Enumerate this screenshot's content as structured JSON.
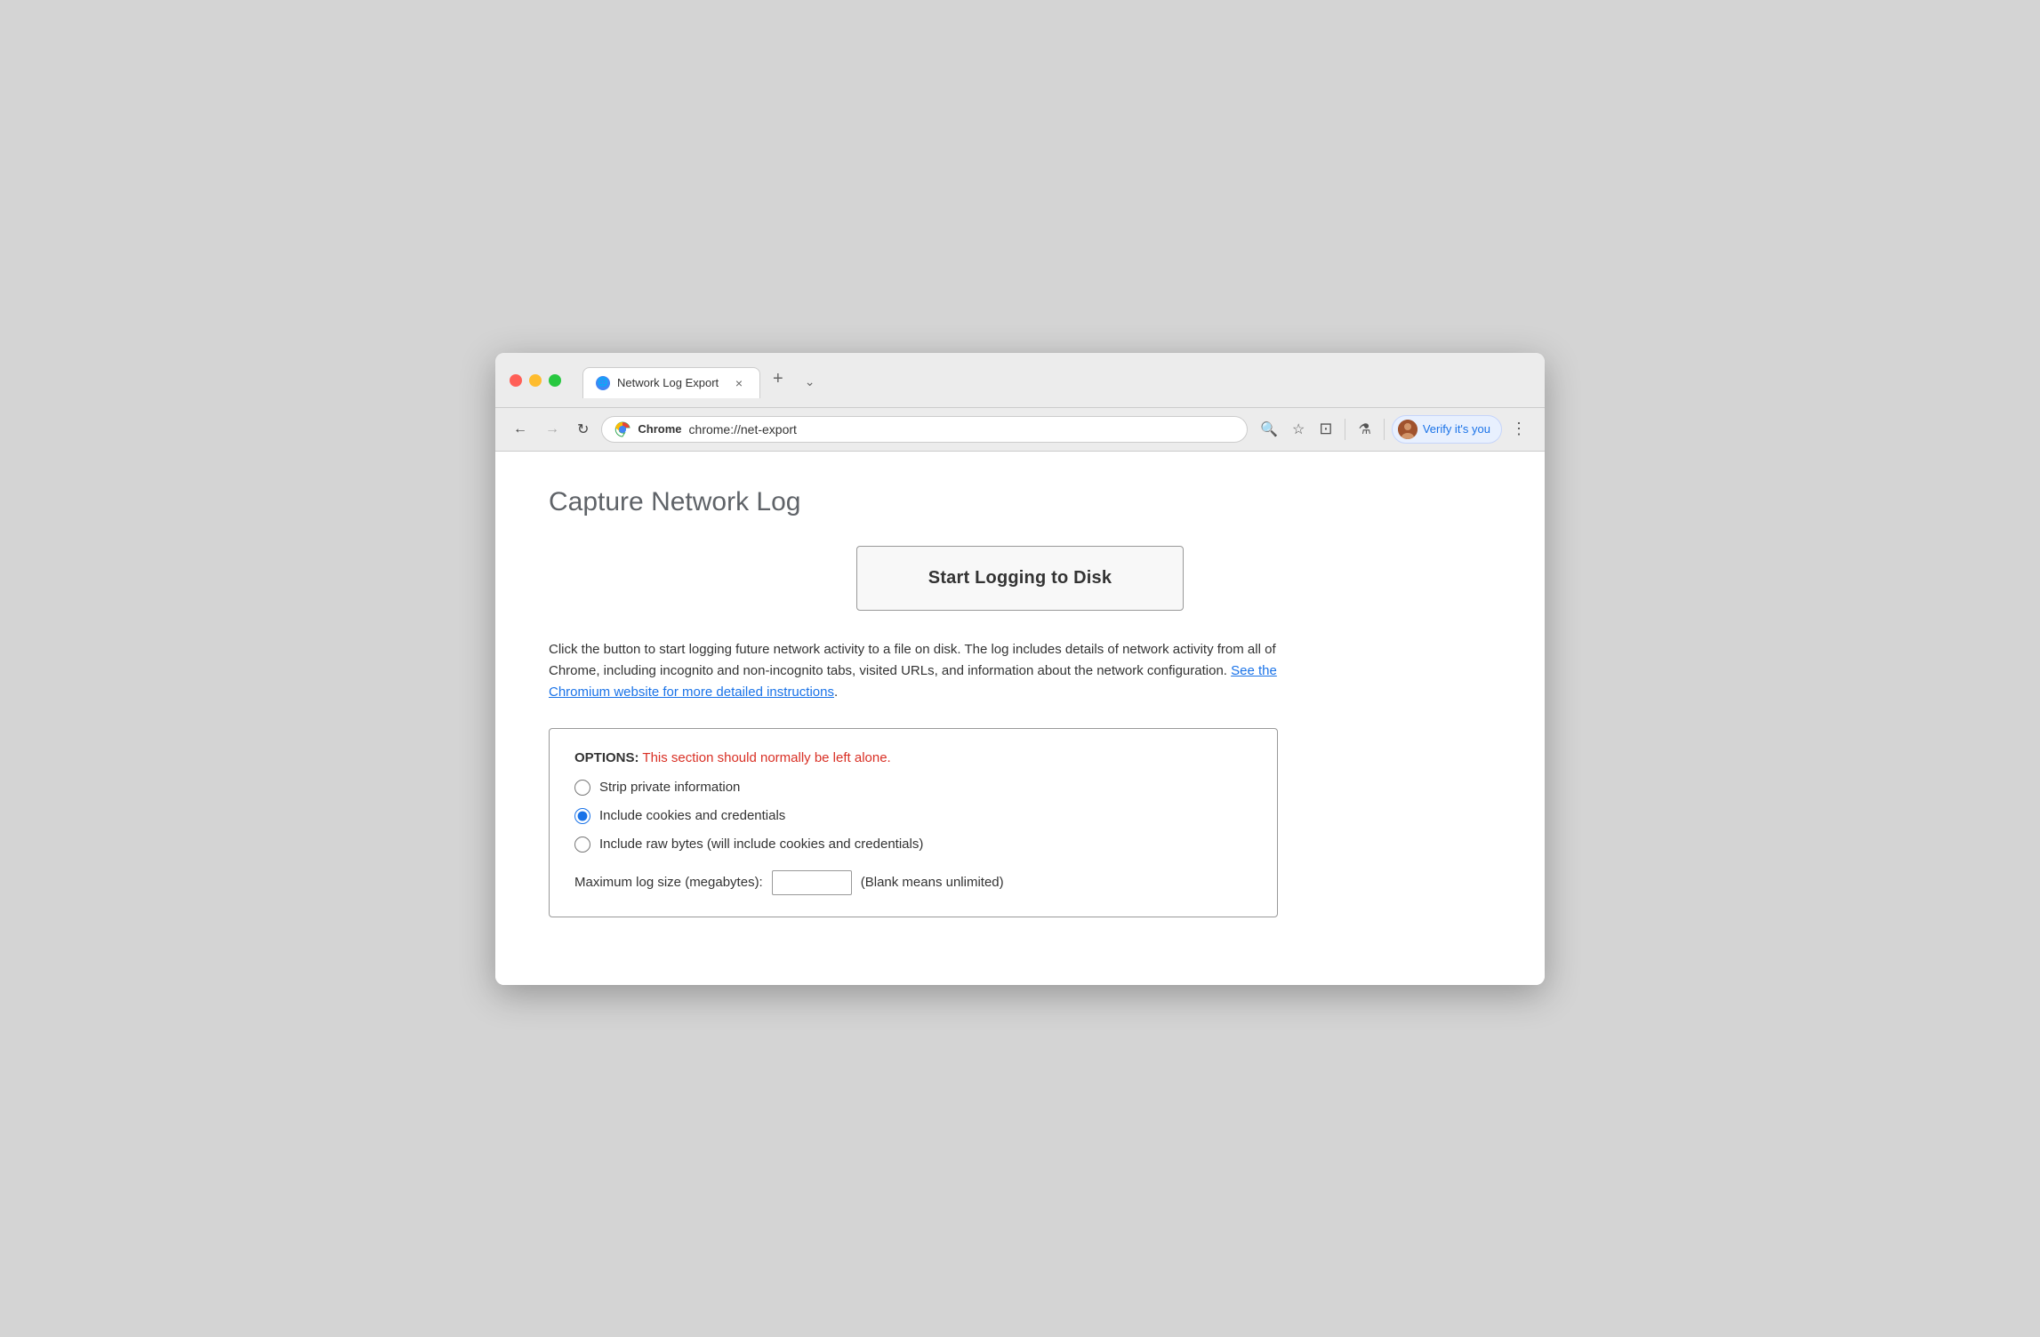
{
  "window": {
    "buttons": {
      "close": "close",
      "minimize": "minimize",
      "maximize": "maximize"
    }
  },
  "tab": {
    "icon": "🌐",
    "title": "Network Log Export",
    "close_label": "×"
  },
  "tabs_bar": {
    "new_tab_label": "+",
    "dropdown_label": "⌄"
  },
  "nav": {
    "back_label": "←",
    "forward_label": "→",
    "reload_label": "↻",
    "chrome_brand": "Chrome",
    "url": "chrome://net-export",
    "search_icon": "🔍",
    "star_icon": "☆",
    "extension_icon": "⊡",
    "lab_icon": "⚗",
    "profile_label": "Verify it's you",
    "menu_label": "⋮"
  },
  "page": {
    "title": "Capture Network Log",
    "start_button": "Start Logging to Disk",
    "description_pre": "Click the button to start logging future network activity to a file on disk. The log includes details of network activity from all of Chrome, including incognito and non-incognito tabs, visited URLs, and information about the network configuration. ",
    "description_link": "See the Chromium website for more detailed instructions",
    "description_post": ".",
    "options": {
      "header_bold": "OPTIONS:",
      "header_warning": " This section should normally be left alone.",
      "radio_items": [
        {
          "id": "strip",
          "label": "Strip private information",
          "checked": false
        },
        {
          "id": "cookies",
          "label": "Include cookies and credentials",
          "checked": true
        },
        {
          "id": "raw",
          "label": "Include raw bytes (will include cookies and credentials)",
          "checked": false
        }
      ],
      "max_log_label": "Maximum log size (megabytes):",
      "max_log_value": "",
      "max_log_placeholder": "",
      "max_log_suffix": "(Blank means unlimited)"
    }
  }
}
